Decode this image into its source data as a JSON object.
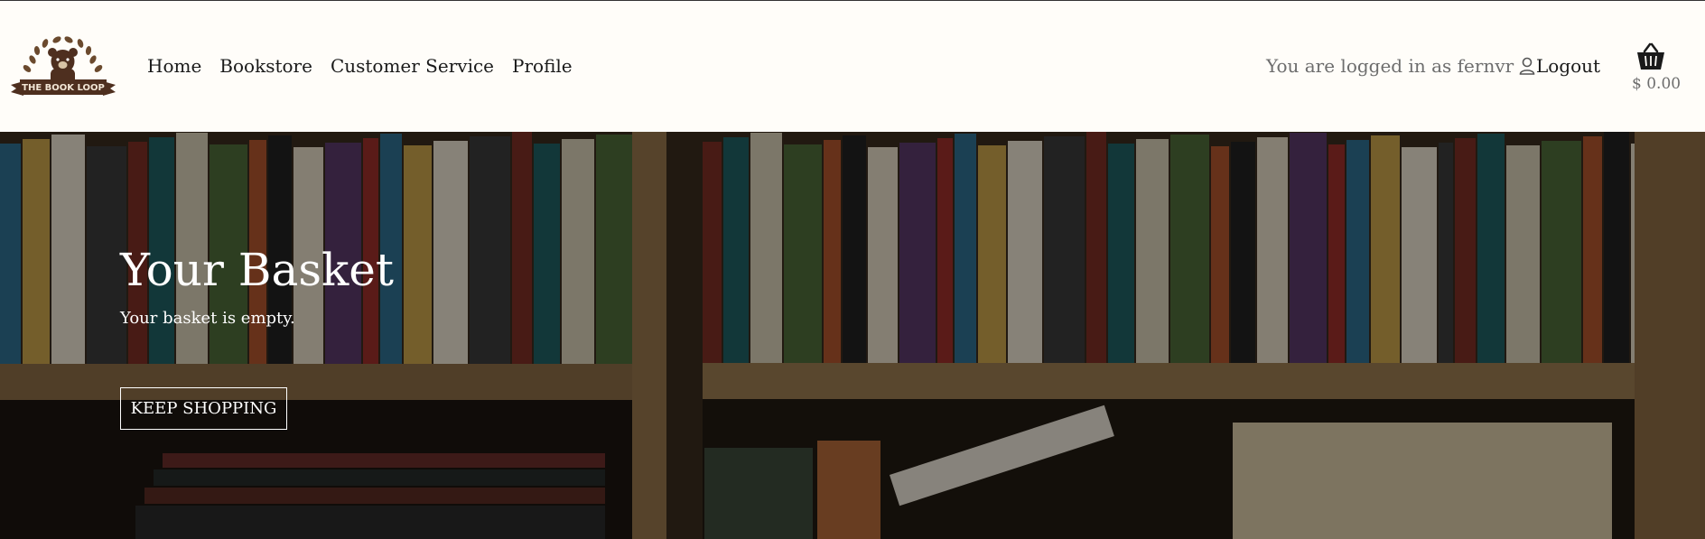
{
  "brand": {
    "logo_text": "THE BOOK LOOP"
  },
  "nav": [
    "Home",
    "Bookstore",
    "Customer Service",
    "Profile"
  ],
  "account": {
    "logged_in_text": "You are logged in as fernvr",
    "logout_label": "Logout"
  },
  "basket": {
    "total": "$ 0.00"
  },
  "hero": {
    "title": "Your Basket",
    "subtitle": "Your basket is empty.",
    "button_label": "KEEP SHOPPING"
  },
  "colors": {
    "brand_brown": "#4e2f1f",
    "header_bg": "#fffdf9"
  }
}
